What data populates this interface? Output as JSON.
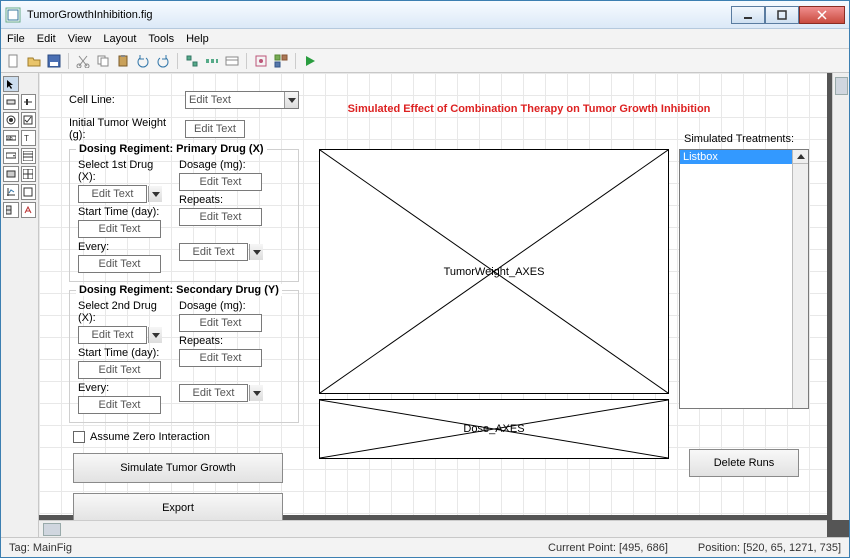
{
  "window": {
    "title": "TumorGrowthInhibition.fig"
  },
  "menu": {
    "file": "File",
    "edit": "Edit",
    "view": "View",
    "layout": "Layout",
    "tools": "Tools",
    "help": "Help"
  },
  "form": {
    "cell_line_label": "Cell Line:",
    "cell_line_value": "Edit Text",
    "tumor_weight_label": "Initial Tumor Weight (g):",
    "tumor_weight_value": "Edit Text",
    "group1": {
      "title": "Dosing Regiment: Primary Drug (X)",
      "select_label": "Select 1st Drug (X):",
      "select_value": "Edit Text",
      "dosage_label": "Dosage (mg):",
      "dosage_value": "Edit Text",
      "start_label": "Start Time (day):",
      "start_value": "Edit Text",
      "repeats_label": "Repeats:",
      "repeats_value": "Edit Text",
      "every_label": "Every:",
      "every_value": "Edit Text",
      "every_unit": "Edit Text"
    },
    "group2": {
      "title": "Dosing Regiment: Secondary Drug (Y)",
      "select_label": "Select 2nd Drug (X):",
      "select_value": "Edit Text",
      "dosage_label": "Dosage (mg):",
      "dosage_value": "Edit Text",
      "start_label": "Start Time (day):",
      "start_value": "Edit Text",
      "repeats_label": "Repeats:",
      "repeats_value": "Edit Text",
      "every_label": "Every:",
      "every_value": "Edit Text",
      "every_unit": "Edit Text"
    },
    "assume_label": "Assume Zero Interaction",
    "simulate_btn": "Simulate Tumor Growth",
    "export_btn": "Export"
  },
  "plot": {
    "title": "Simulated Effect of Combination Therapy on Tumor Growth Inhibition",
    "axes1": "TumorWeight_AXES",
    "axes2": "Dose_AXES"
  },
  "sidepanel": {
    "label": "Simulated Treatments:",
    "list_item": "Listbox",
    "delete_btn": "Delete Runs"
  },
  "status": {
    "tag": "Tag: MainFig",
    "current": "Current Point: [495, 686]",
    "position": "Position: [520, 65, 1271, 735]"
  }
}
